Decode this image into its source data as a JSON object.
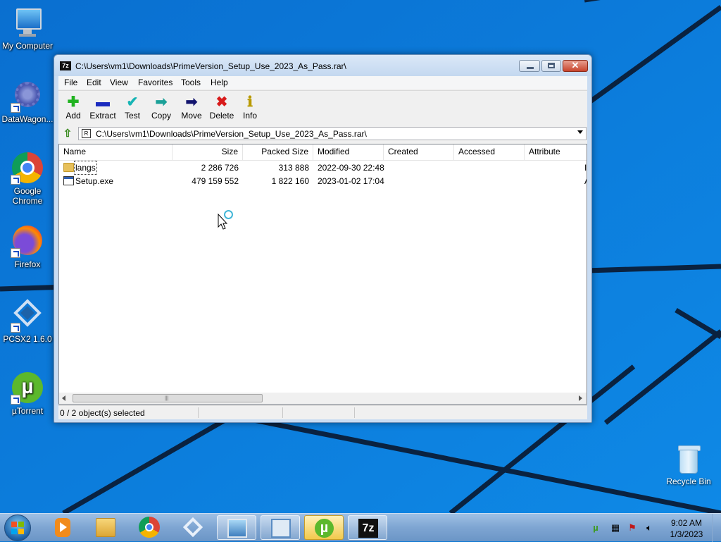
{
  "desktop": {
    "icons": [
      {
        "label": "My Computer"
      },
      {
        "label": "DataWagon..."
      },
      {
        "label": "Google Chrome"
      },
      {
        "label": "Firefox"
      },
      {
        "label": "PCSX2 1.6.0"
      },
      {
        "label": "µTorrent"
      }
    ],
    "recycle_bin": "Recycle Bin"
  },
  "window": {
    "app_icon_text": "7z",
    "title": "C:\\Users\\vm1\\Downloads\\PrimeVersion_Setup_Use_2023_As_Pass.rar\\",
    "close_glyph": "✕"
  },
  "menu": [
    "File",
    "Edit",
    "View",
    "Favorites",
    "Tools",
    "Help"
  ],
  "toolbar": [
    {
      "label": "Add",
      "glyph": "✚",
      "color": "#21b321"
    },
    {
      "label": "Extract",
      "glyph": "▬",
      "color": "#1b2bbf"
    },
    {
      "label": "Test",
      "glyph": "✔",
      "color": "#18b5b5"
    },
    {
      "label": "Copy",
      "glyph": "➡",
      "color": "#1aa098"
    },
    {
      "label": "Move",
      "glyph": "➡",
      "color": "#12146e"
    },
    {
      "label": "Delete",
      "glyph": "✖",
      "color": "#d81b1b"
    },
    {
      "label": "Info",
      "glyph": "ℹ",
      "color": "#b89a00"
    }
  ],
  "address": {
    "icon_text": "R",
    "path": "C:\\Users\\vm1\\Downloads\\PrimeVersion_Setup_Use_2023_As_Pass.rar\\"
  },
  "columns": [
    "Name",
    "Size",
    "Packed Size",
    "Modified",
    "Created",
    "Accessed",
    "Attribute"
  ],
  "files": [
    {
      "name": "langs",
      "size": "2 286 726",
      "packed": "313 888",
      "modified": "2022-09-30 22:48",
      "created": "",
      "accessed": "",
      "attr": "I",
      "type": "folder"
    },
    {
      "name": "Setup.exe",
      "size": "479 159 552",
      "packed": "1 822 160",
      "modified": "2023-01-02 17:04",
      "created": "",
      "accessed": "",
      "attr": "A",
      "type": "exe"
    }
  ],
  "scroll_grip": "|||",
  "status": "0 / 2 object(s) selected",
  "taskbar": {
    "apps": [
      "media-player",
      "file-explorer",
      "google-chrome",
      "pcsx2",
      "image-viewer",
      "control-panel",
      "utorrent",
      "7zip"
    ],
    "sevenzip_label": "7z"
  },
  "tray": {
    "time": "9:02 AM",
    "date": "1/3/2023"
  }
}
